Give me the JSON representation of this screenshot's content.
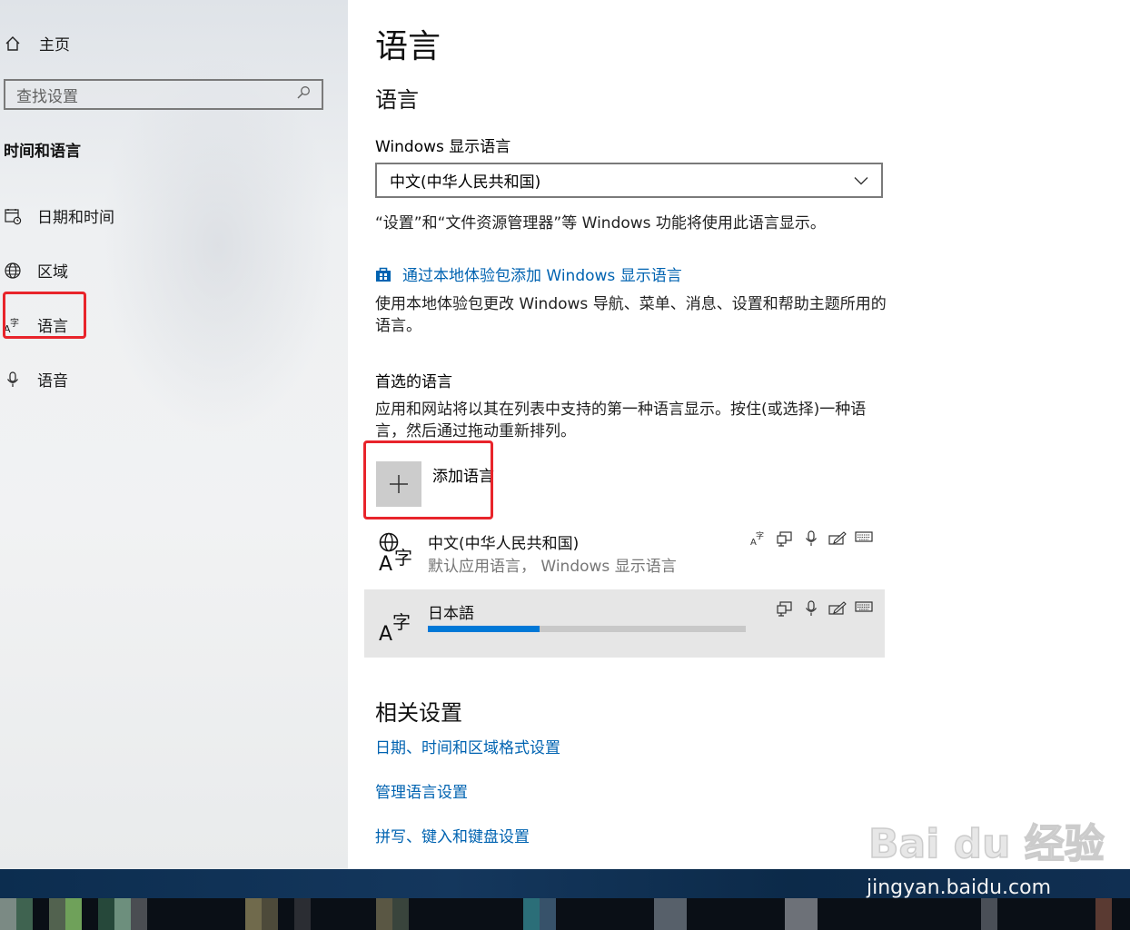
{
  "sidebar": {
    "home_label": "主页",
    "search_placeholder": "查找设置",
    "section_title": "时间和语言",
    "items": [
      {
        "label": "日期和时间",
        "icon": "calendar-clock-icon"
      },
      {
        "label": "区域",
        "icon": "globe-icon"
      },
      {
        "label": "语言",
        "icon": "language-icon"
      },
      {
        "label": "语音",
        "icon": "microphone-icon"
      }
    ]
  },
  "main": {
    "page_title": "语言",
    "section_title": "语言",
    "display_language": {
      "label": "Windows 显示语言",
      "selected": "中文(中华人民共和国)",
      "note": "“设置”和“文件资源管理器”等 Windows 功能将使用此语言显示。"
    },
    "lxp": {
      "link": "通过本地体验包添加 Windows 显示语言",
      "desc": "使用本地体验包更改 Windows 导航、菜单、消息、设置和帮助主题所用的语言。"
    },
    "preferred": {
      "title": "首选的语言",
      "desc": "应用和网站将以其在列表中支持的第一种语言显示。按住(或选择)一种语言，然后通过拖动重新排列。",
      "add_label": "添加语言",
      "languages": [
        {
          "name": "中文(中华人民共和国)",
          "sub": "默认应用语言，  Windows 显示语言"
        },
        {
          "name": "日本語",
          "progress": 0.35
        }
      ]
    },
    "related": {
      "title": "相关设置",
      "links": [
        "日期、时间和区域格式设置",
        "管理语言设置",
        "拼写、键入和键盘设置"
      ]
    }
  },
  "watermark": {
    "logo": "Bai du 经验",
    "url": "jingyan.baidu.com"
  },
  "colors": {
    "accent": "#0078d7",
    "link": "#0063b1",
    "highlight": "#e8242b"
  }
}
